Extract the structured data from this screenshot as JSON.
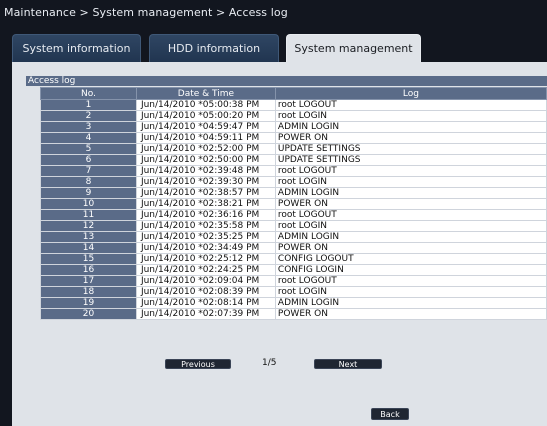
{
  "breadcrumb": "Maintenance > System management > Access log",
  "tabs": [
    {
      "label": "System information",
      "active": false
    },
    {
      "label": "HDD information",
      "active": false
    },
    {
      "label": "System management",
      "active": true
    }
  ],
  "section_title": "Access log",
  "table": {
    "headers": [
      "No.",
      "Date & Time",
      "Log"
    ],
    "rows": [
      {
        "no": "1",
        "datetime": "Jun/14/2010 *05:00:38 PM",
        "log": "root LOGOUT"
      },
      {
        "no": "2",
        "datetime": "Jun/14/2010 *05:00:20 PM",
        "log": "root LOGIN"
      },
      {
        "no": "3",
        "datetime": "Jun/14/2010 *04:59:47 PM",
        "log": "ADMIN LOGIN"
      },
      {
        "no": "4",
        "datetime": "Jun/14/2010 *04:59:11 PM",
        "log": "POWER ON"
      },
      {
        "no": "5",
        "datetime": "Jun/14/2010 *02:52:00 PM",
        "log": "UPDATE SETTINGS"
      },
      {
        "no": "6",
        "datetime": "Jun/14/2010 *02:50:00 PM",
        "log": "UPDATE SETTINGS"
      },
      {
        "no": "7",
        "datetime": "Jun/14/2010 *02:39:48 PM",
        "log": "root LOGOUT"
      },
      {
        "no": "8",
        "datetime": "Jun/14/2010 *02:39:30 PM",
        "log": "root LOGIN"
      },
      {
        "no": "9",
        "datetime": "Jun/14/2010 *02:38:57 PM",
        "log": "ADMIN LOGIN"
      },
      {
        "no": "10",
        "datetime": "Jun/14/2010 *02:38:21 PM",
        "log": "POWER ON"
      },
      {
        "no": "11",
        "datetime": "Jun/14/2010 *02:36:16 PM",
        "log": "root LOGOUT"
      },
      {
        "no": "12",
        "datetime": "Jun/14/2010 *02:35:58 PM",
        "log": "root LOGIN"
      },
      {
        "no": "13",
        "datetime": "Jun/14/2010 *02:35:25 PM",
        "log": "ADMIN LOGIN"
      },
      {
        "no": "14",
        "datetime": "Jun/14/2010 *02:34:49 PM",
        "log": "POWER ON"
      },
      {
        "no": "15",
        "datetime": "Jun/14/2010 *02:25:12 PM",
        "log": "CONFIG LOGOUT"
      },
      {
        "no": "16",
        "datetime": "Jun/14/2010 *02:24:25 PM",
        "log": "CONFIG LOGIN"
      },
      {
        "no": "17",
        "datetime": "Jun/14/2010 *02:09:04 PM",
        "log": "root LOGOUT"
      },
      {
        "no": "18",
        "datetime": "Jun/14/2010 *02:08:39 PM",
        "log": "root LOGIN"
      },
      {
        "no": "19",
        "datetime": "Jun/14/2010 *02:08:14 PM",
        "log": "ADMIN LOGIN"
      },
      {
        "no": "20",
        "datetime": "Jun/14/2010 *02:07:39 PM",
        "log": "POWER ON"
      }
    ]
  },
  "pagination": {
    "previous_label": "Previous",
    "next_label": "Next",
    "indicator": "1/5"
  },
  "back_label": "Back"
}
